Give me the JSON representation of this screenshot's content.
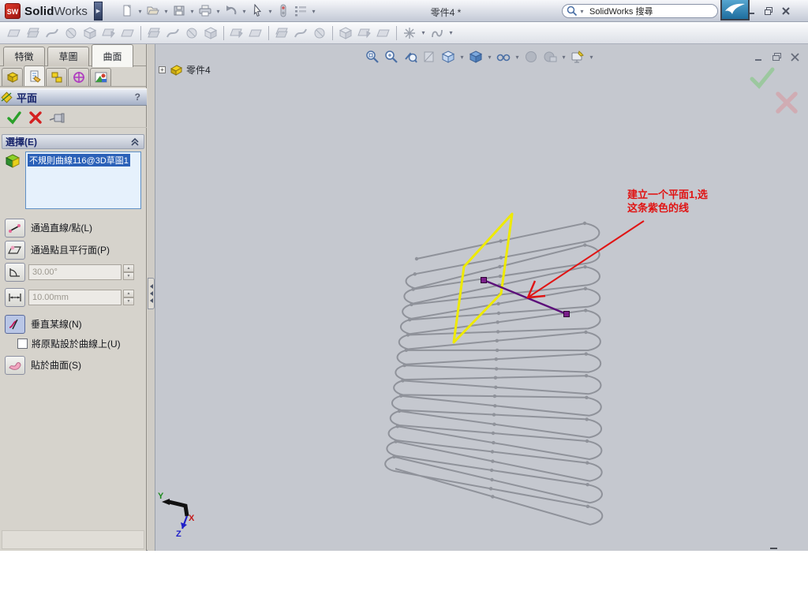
{
  "titlebar": {
    "logo_sw": "SW",
    "logo_solid": "Solid",
    "logo_works": "Works",
    "logo_arrow": "▶",
    "document_title": "零件4 *",
    "search_text": "SolidWorks 搜尋",
    "help_label": "?",
    "std_tools": [
      {
        "name": "new-document",
        "caret": true
      },
      {
        "name": "open",
        "caret": true
      },
      {
        "name": "save",
        "caret": true
      },
      {
        "name": "print",
        "caret": true
      },
      {
        "name": "undo",
        "caret": true
      },
      {
        "name": "select",
        "caret": true
      },
      {
        "name": "rebuild",
        "caret": false
      },
      {
        "name": "options",
        "caret": true
      }
    ]
  },
  "surface_toolbar": [
    {
      "name": "extruded-surface"
    },
    {
      "name": "revolved-surface"
    },
    {
      "name": "swept-surface"
    },
    {
      "name": "lofted-surface"
    },
    {
      "name": "boundary-surface"
    },
    {
      "name": "filled-surface"
    },
    {
      "name": "freeform"
    },
    {
      "name": "sep"
    },
    {
      "name": "planar-surface"
    },
    {
      "name": "offset-surface"
    },
    {
      "name": "ruled-surface"
    },
    {
      "name": "delete-face"
    },
    {
      "name": "sep"
    },
    {
      "name": "replace-face"
    },
    {
      "name": "untrim-surface"
    },
    {
      "name": "sep"
    },
    {
      "name": "extend-surface"
    },
    {
      "name": "trim-surface"
    },
    {
      "name": "knit-surface"
    },
    {
      "name": "sep"
    },
    {
      "name": "thicken"
    },
    {
      "name": "thickened-cut"
    },
    {
      "name": "cut-with-surface"
    },
    {
      "name": "sep"
    },
    {
      "name": "reference-geometry",
      "caret": true
    },
    {
      "name": "curves",
      "caret": true
    }
  ],
  "command_tabs": [
    {
      "label": "特徵",
      "active": false
    },
    {
      "label": "草圖",
      "active": false
    },
    {
      "label": "曲面",
      "active": true
    }
  ],
  "pm_tabs": [
    "features",
    "properties",
    "configurations",
    "dimxpert",
    "display"
  ],
  "pm": {
    "title": "平面",
    "help": "?",
    "group": "選擇(E)",
    "selection": "不規則曲線116@3D草圖1",
    "opt_line_point": "通過直線/點(L)",
    "opt_parallel": "通過點且平行面(P)",
    "angle_value": "30.00°",
    "distance_value": "10.00mm",
    "opt_normal": "垂直某線(N)",
    "chk_origin": "將原點設於曲線上(U)",
    "opt_on_surface": "貼於曲面(S)"
  },
  "hud_tools": [
    {
      "name": "zoom-to-fit"
    },
    {
      "name": "zoom-to-area"
    },
    {
      "name": "previous-view"
    },
    {
      "name": "section-view",
      "disabled": true
    },
    {
      "name": "view-orientation",
      "caret": true
    },
    {
      "name": "display-style",
      "caret": true
    },
    {
      "name": "hide-show-items",
      "caret": true
    },
    {
      "name": "edit-appearance",
      "disabled": true
    },
    {
      "name": "apply-scene",
      "disabled": true,
      "caret": true
    },
    {
      "name": "view-settings",
      "caret": true
    }
  ],
  "viewport": {
    "tree_root": "零件4",
    "annotation": [
      "建立一个平面1,选",
      "这条紫色的线"
    ],
    "axis_labels": {
      "x": "X",
      "y": "Y",
      "z": "Z"
    }
  },
  "colors": {
    "annotation_red": "#e01414",
    "sketch_yellow": "#eeea00",
    "line_purple": "#5c0f7a",
    "marker_purple": "#7a1f8a",
    "wire": "#8f929a",
    "viewport_bg": "#c5c8cf"
  },
  "model": {
    "coil_rows": 14
  }
}
